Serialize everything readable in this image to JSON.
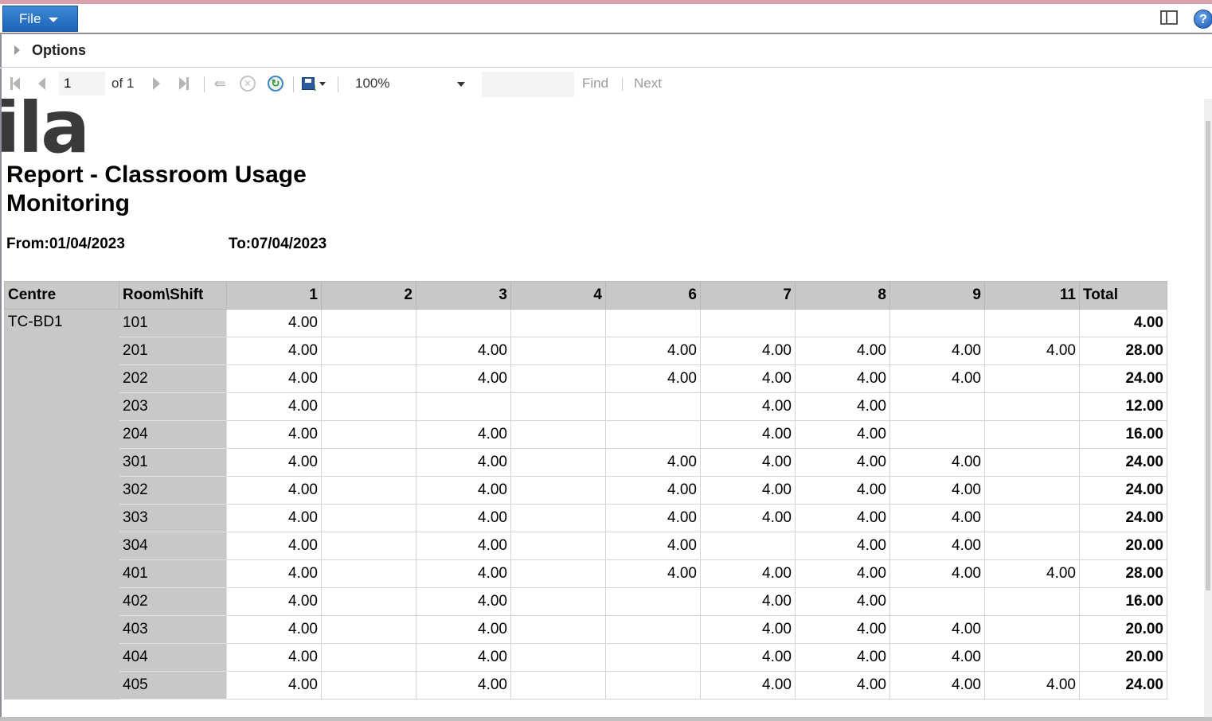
{
  "ribbon": {
    "file_label": "File"
  },
  "options": {
    "label": "Options"
  },
  "toolbar": {
    "page_value": "1",
    "of_text": "of 1",
    "zoom": "100%",
    "find_label": "Find",
    "next_label": "Next"
  },
  "report": {
    "logo_text": "ila",
    "title": "Report - Classroom Usage Monitoring",
    "from_text": "From:01/04/2023",
    "to_text": "To:07/04/2023",
    "headers": [
      "Centre",
      "Room\\Shift",
      "1",
      "2",
      "3",
      "4",
      "6",
      "7",
      "8",
      "9",
      "11",
      "Total"
    ],
    "centre": "TC-BD1",
    "rows": [
      {
        "room": "101",
        "c1": "4.00",
        "c2": "",
        "c3": "",
        "c4": "",
        "c6": "",
        "c7": "",
        "c8": "",
        "c9": "",
        "c11": "",
        "total": "4.00"
      },
      {
        "room": "201",
        "c1": "4.00",
        "c2": "",
        "c3": "4.00",
        "c4": "",
        "c6": "4.00",
        "c7": "4.00",
        "c8": "4.00",
        "c9": "4.00",
        "c11": "4.00",
        "total": "28.00"
      },
      {
        "room": "202",
        "c1": "4.00",
        "c2": "",
        "c3": "4.00",
        "c4": "",
        "c6": "4.00",
        "c7": "4.00",
        "c8": "4.00",
        "c9": "4.00",
        "c11": "",
        "total": "24.00"
      },
      {
        "room": "203",
        "c1": "4.00",
        "c2": "",
        "c3": "",
        "c4": "",
        "c6": "",
        "c7": "4.00",
        "c8": "4.00",
        "c9": "",
        "c11": "",
        "total": "12.00"
      },
      {
        "room": "204",
        "c1": "4.00",
        "c2": "",
        "c3": "4.00",
        "c4": "",
        "c6": "",
        "c7": "4.00",
        "c8": "4.00",
        "c9": "",
        "c11": "",
        "total": "16.00"
      },
      {
        "room": "301",
        "c1": "4.00",
        "c2": "",
        "c3": "4.00",
        "c4": "",
        "c6": "4.00",
        "c7": "4.00",
        "c8": "4.00",
        "c9": "4.00",
        "c11": "",
        "total": "24.00"
      },
      {
        "room": "302",
        "c1": "4.00",
        "c2": "",
        "c3": "4.00",
        "c4": "",
        "c6": "4.00",
        "c7": "4.00",
        "c8": "4.00",
        "c9": "4.00",
        "c11": "",
        "total": "24.00"
      },
      {
        "room": "303",
        "c1": "4.00",
        "c2": "",
        "c3": "4.00",
        "c4": "",
        "c6": "4.00",
        "c7": "4.00",
        "c8": "4.00",
        "c9": "4.00",
        "c11": "",
        "total": "24.00"
      },
      {
        "room": "304",
        "c1": "4.00",
        "c2": "",
        "c3": "4.00",
        "c4": "",
        "c6": "4.00",
        "c7": "",
        "c8": "4.00",
        "c9": "4.00",
        "c11": "",
        "total": "20.00"
      },
      {
        "room": "401",
        "c1": "4.00",
        "c2": "",
        "c3": "4.00",
        "c4": "",
        "c6": "4.00",
        "c7": "4.00",
        "c8": "4.00",
        "c9": "4.00",
        "c11": "4.00",
        "total": "28.00"
      },
      {
        "room": "402",
        "c1": "4.00",
        "c2": "",
        "c3": "4.00",
        "c4": "",
        "c6": "",
        "c7": "4.00",
        "c8": "4.00",
        "c9": "",
        "c11": "",
        "total": "16.00"
      },
      {
        "room": "403",
        "c1": "4.00",
        "c2": "",
        "c3": "4.00",
        "c4": "",
        "c6": "",
        "c7": "4.00",
        "c8": "4.00",
        "c9": "4.00",
        "c11": "",
        "total": "20.00"
      },
      {
        "room": "404",
        "c1": "4.00",
        "c2": "",
        "c3": "4.00",
        "c4": "",
        "c6": "",
        "c7": "4.00",
        "c8": "4.00",
        "c9": "4.00",
        "c11": "",
        "total": "20.00"
      },
      {
        "room": "405",
        "c1": "4.00",
        "c2": "",
        "c3": "4.00",
        "c4": "",
        "c6": "",
        "c7": "4.00",
        "c8": "4.00",
        "c9": "4.00",
        "c11": "4.00",
        "total": "24.00"
      }
    ]
  },
  "colors": {
    "file_button": "#1c63b7",
    "header_fill": "#c8c8c8",
    "top_strip": "#d9a0ab"
  }
}
